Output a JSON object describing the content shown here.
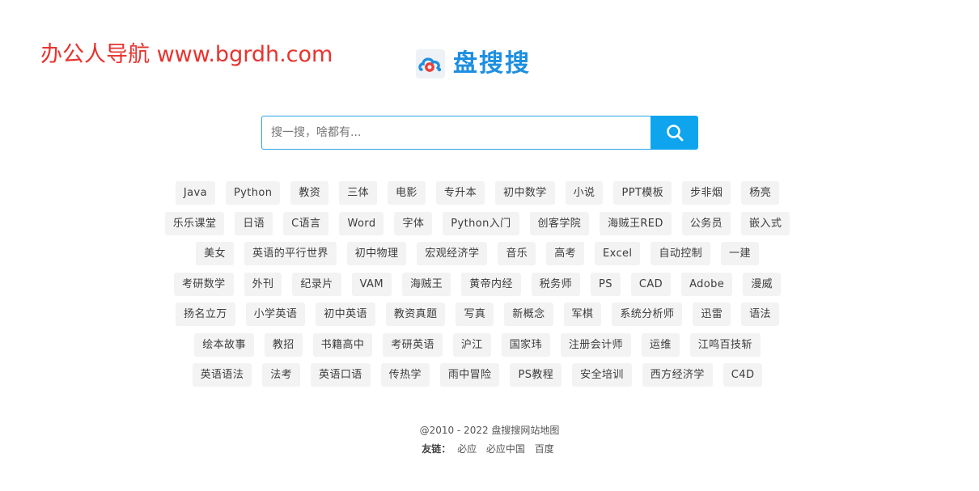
{
  "watermark": "办公人导航 www.bgrdh.com",
  "logo": {
    "text": "盘搜搜",
    "icon": "cloud-search-logo-icon"
  },
  "search": {
    "placeholder": "搜一搜，啥都有...",
    "value": "",
    "button_icon": "search-icon"
  },
  "tag_rows": [
    [
      "Java",
      "Python",
      "教资",
      "三体",
      "电影",
      "专升本",
      "初中数学",
      "小说",
      "PPT模板",
      "步非烟",
      "杨亮"
    ],
    [
      "乐乐课堂",
      "日语",
      "C语言",
      "Word",
      "字体",
      "Python入门",
      "创客学院",
      "海贼王RED",
      "公务员",
      "嵌入式"
    ],
    [
      "美女",
      "英语的平行世界",
      "初中物理",
      "宏观经济学",
      "音乐",
      "高考",
      "Excel",
      "自动控制",
      "一建"
    ],
    [
      "考研数学",
      "外刊",
      "纪录片",
      "VAM",
      "海贼王",
      "黄帝内经",
      "税务师",
      "PS",
      "CAD",
      "Adobe",
      "漫威"
    ],
    [
      "扬名立万",
      "小学英语",
      "初中英语",
      "教资真题",
      "写真",
      "新概念",
      "军棋",
      "系统分析师",
      "迅雷",
      "语法"
    ],
    [
      "绘本故事",
      "教招",
      "书籍高中",
      "考研英语",
      "沪江",
      "国家玮",
      "注册会计师",
      "运维",
      "江鸣百技斩"
    ],
    [
      "英语语法",
      "法考",
      "英语口语",
      "传热学",
      "雨中冒险",
      "PS教程",
      "安全培训",
      "西方经济学",
      "C4D"
    ]
  ],
  "footer": {
    "copyright": "@2010 - 2022 盘搜搜网站地图",
    "friend_label": "友链：",
    "friend_links": [
      "必应",
      "必应中国",
      "百度"
    ]
  },
  "colors": {
    "accent": "#0ea5ee",
    "logo_text": "#1e8fe0",
    "watermark": "#e8332f",
    "tag_bg": "#f3f3f3"
  }
}
